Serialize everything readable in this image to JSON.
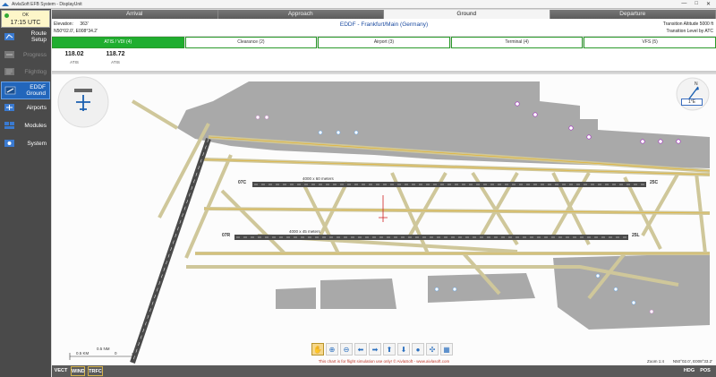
{
  "window": {
    "title": "AivlaSoft EFB System - DisplayUnit",
    "controls": [
      "—",
      "□",
      "✕"
    ]
  },
  "clock": {
    "status": "OK",
    "time": "17:15 UTC"
  },
  "sidebar": {
    "items": [
      {
        "label": "Route Setup",
        "icon": "route-icon"
      },
      {
        "label": "Progress",
        "icon": "progress-icon"
      },
      {
        "label": "Flightlog",
        "icon": "flightlog-icon"
      },
      {
        "label": "EDDF Ground",
        "icon": "airport-chart-icon"
      },
      {
        "label": "Airports",
        "icon": "airports-icon"
      },
      {
        "label": "Modules",
        "icon": "modules-icon"
      },
      {
        "label": "System",
        "icon": "system-icon"
      }
    ]
  },
  "top_tabs": [
    "Arrival",
    "Approach",
    "Ground",
    "Departure"
  ],
  "info": {
    "elevation_label": "Elevation:",
    "elevation_value": "363'",
    "coords": "N50°02.0', E008°34.2'",
    "airport": "EDDF - Frankfurt/Main (Germany)",
    "transition_altitude": "Transition Altitude 5000 ft",
    "transition_level": "Transition Level by ATC"
  },
  "freq_tabs": [
    "ATIS / VDI (4)",
    "Clearance (2)",
    "Airport (3)",
    "Terminal (4)",
    "VFS (5)"
  ],
  "frequencies": [
    {
      "value": "118.02",
      "name": "ATIS"
    },
    {
      "value": "118.72",
      "name": "ATIS"
    }
  ],
  "chart": {
    "runway_dims_1": "4000 x 60 meters",
    "runway_dims_2": "4000 x 45 meters",
    "rwy_07c": "07C",
    "rwy_25c": "25C",
    "rwy_07r": "07R",
    "rwy_25l": "25L",
    "scale_top": "0.5 NM",
    "scale_km": "0.5 KM",
    "scale_zero": "0",
    "disclaimer": "This chart is for flight simulation use only! © AivlaSoft - www.aivlasoft.com",
    "zoom": "Zoom 1:4",
    "cursor_pos": "N50°02.0', E008°33.2'",
    "compass_label": "1°E"
  },
  "bottom_buttons": {
    "left": [
      "VECT",
      "WIND",
      "TRFC"
    ],
    "right": [
      "HDG",
      "POS"
    ]
  },
  "colors": {
    "accent": "#2266bb",
    "active_freq_tab": "#1fae2f",
    "runway": "#4a4a4a",
    "taxiway": "#cfc79a",
    "apron": "#a9a9a9"
  }
}
